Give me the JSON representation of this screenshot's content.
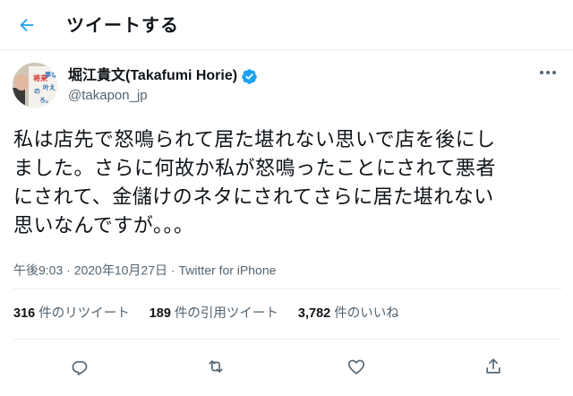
{
  "header": {
    "title": "ツイートする",
    "back_icon": "arrow-left-icon",
    "accent": "#1da1f2"
  },
  "author": {
    "display_name": "堀江貴文(Takafumi Horie)",
    "handle": "@takapon_jp",
    "verified": true,
    "verified_color": "#1da1f2",
    "avatar_book_text": "将来の夢なんか、まだ叶えろ。"
  },
  "tweet": {
    "text_lines": [
      "私は店先で怒鳴られて居た堪れない思いで店を後にし",
      "ました。さらに何故か私が怒鳴ったことにされて悪者",
      "にされて、金儲けのネタにされてさらに居た堪れない",
      "思いなんですが。。。"
    ],
    "time": "午後9:03",
    "separator": "·",
    "date": "2020年10月27日",
    "source": "Twitter for iPhone"
  },
  "stats": {
    "retweets": {
      "count": "316",
      "label": "件のリツイート"
    },
    "quotes": {
      "count": "189",
      "label": "件の引用ツイート"
    },
    "likes": {
      "count": "3,782",
      "label": "件のいいね"
    }
  },
  "actions": {
    "reply_icon": "reply-icon",
    "retweet_icon": "retweet-icon",
    "like_icon": "heart-icon",
    "share_icon": "share-icon",
    "icon_color": "#536471"
  }
}
